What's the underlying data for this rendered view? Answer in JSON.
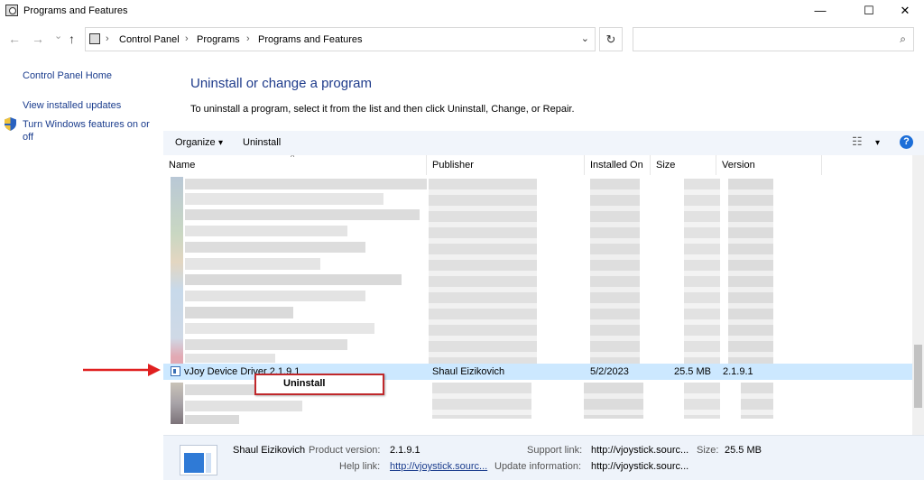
{
  "window": {
    "title": "Programs and Features",
    "minimize": "—",
    "maximize": "☐",
    "close": "✕"
  },
  "nav": {
    "back": "←",
    "forward": "→",
    "recent": "⌄",
    "up": "↑",
    "breadcrumb": [
      "Control Panel",
      "Programs",
      "Programs and Features"
    ],
    "separator": "›",
    "dropdown": "⌄",
    "refresh": "↻",
    "search_placeholder": "",
    "search_icon": "⌕"
  },
  "sidebar": {
    "items": [
      {
        "label": "Control Panel Home"
      },
      {
        "label": "View installed updates"
      },
      {
        "label": "Turn Windows features on or"
      },
      {
        "label": "off"
      }
    ]
  },
  "main": {
    "heading": "Uninstall or change a program",
    "subtext": "To uninstall a program, select it from the list and then click Uninstall, Change, or Repair."
  },
  "toolbar": {
    "organize": "Organize",
    "organize_arrow": "▾",
    "uninstall": "Uninstall",
    "view_icon": "☷",
    "view_arrow": "▾",
    "help": "?"
  },
  "columns": [
    "Name",
    "Publisher",
    "Installed On",
    "Size",
    "Version"
  ],
  "sort_arrow": "^",
  "selected_row": {
    "name": "vJoy Device Driver 2.1.9.1",
    "publisher": "Shaul Eizikovich",
    "installed_on": "5/2/2023",
    "size": "25.5 MB",
    "version": "2.1.9.1"
  },
  "context_menu": {
    "item": "Uninstall"
  },
  "details": {
    "publisher": "Shaul Eizikovich",
    "product_version_label": "Product version:",
    "product_version": "2.1.9.1",
    "support_link_label": "Support link:",
    "support_link": "http://vjoystick.sourc...",
    "size_label": "Size:",
    "size": "25.5 MB",
    "help_link_label": "Help link:",
    "help_link": "http://vjoystick.sourc...",
    "update_info_label": "Update information:",
    "update_info": "http://vjoystick.sourc..."
  },
  "colors": {
    "link": "#1a3c8d",
    "heading": "#1e3b8b",
    "selection": "#cce8ff",
    "annotation": "#e02020"
  }
}
